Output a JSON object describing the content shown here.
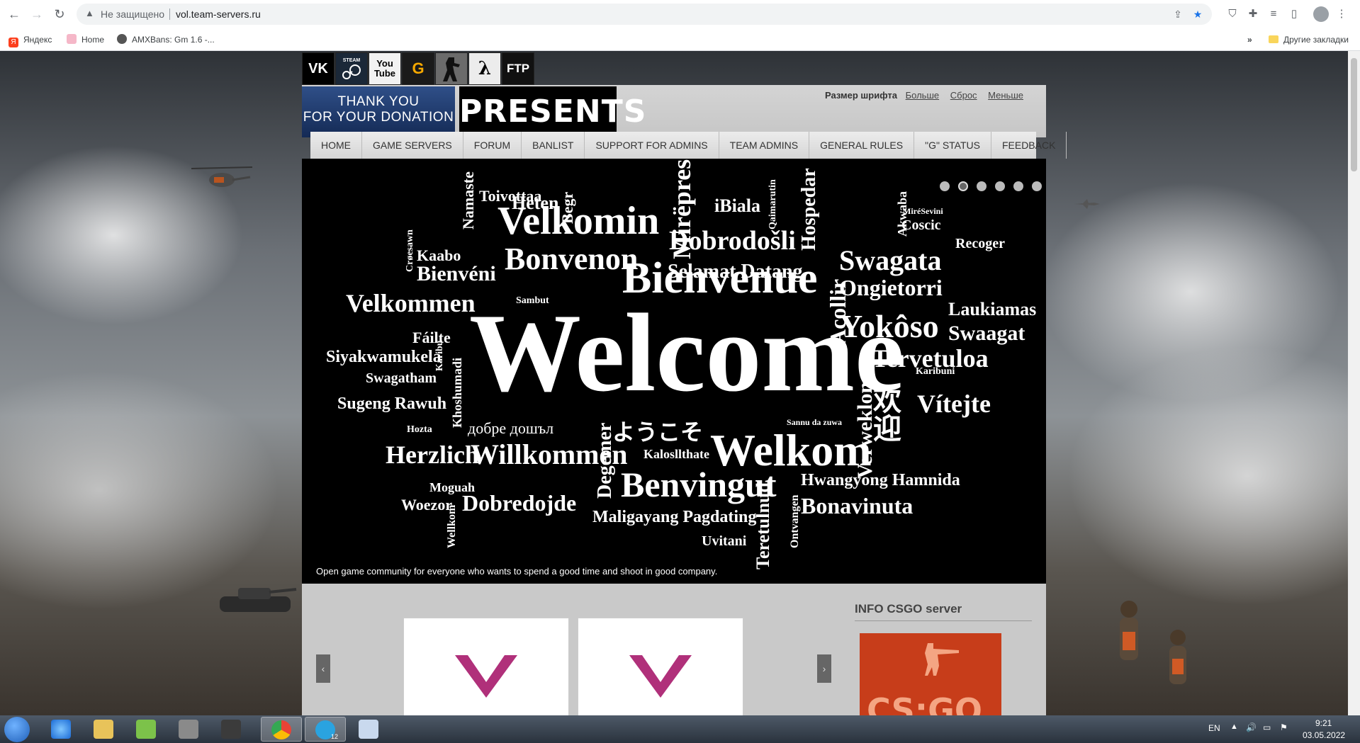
{
  "browser": {
    "not_secure": "Не защищено",
    "url": "vol.team-servers.ru",
    "bookmarks": [
      "Яндекс",
      "Home",
      "AMXBans: Gm 1.6 -..."
    ],
    "other_bookmarks": "Другие закладки",
    "overflow": "»"
  },
  "site": {
    "social": [
      "VK",
      "STEAM",
      "You Tube",
      "GameTracker",
      "Counter-Strike",
      "Half-Life",
      "FTP"
    ],
    "donation": {
      "line1": "THANK YOU",
      "line2": "FOR YOUR DONATION"
    },
    "presents": "PRESENTS",
    "font_size": {
      "label": "Размер шрифта",
      "bigger": "Больше",
      "reset": "Сброс",
      "smaller": "Меньше"
    },
    "menu": [
      "HOME",
      "GAME SERVERS",
      "FORUM",
      "BANLIST",
      "SUPPORT FOR ADMINS",
      "TEAM ADMINS",
      "GENERAL RULES",
      "\"G\" STATUS",
      "FEEDBACK"
    ],
    "slider": {
      "dots": 6,
      "active_dot": 1,
      "caption": "Open game community for everyone who wants to spend a good time and shoot in good company.",
      "words": [
        "Welcome",
        "Bienvenue",
        "Velkomin",
        "Bonvenon",
        "Welkom",
        "Willkommen",
        "Benvingut",
        "Bienvéni",
        "Velkommen",
        "Dobrodošli",
        "Selamat Datang",
        "Swagata",
        "Ongietorri",
        "Yokôso",
        "Tervetuloa",
        "Vítejte",
        "Laukiamas",
        "Swaagat",
        "Herzlich",
        "Dobredojde",
        "Maligayang Pagdating",
        "Bonavinuta",
        "Hwangyong Hamnida",
        "Siyakwamukela",
        "Sugeng Rawuh",
        "Swagatham",
        "Fáilte",
        "Kaabo",
        "Namaste",
        "Toivottaa",
        "Heten",
        "iBiala",
        "Hospedar",
        "Mirëpres",
        "Coscic",
        "Recoger",
        "Woezor",
        "Moguah",
        "Uvitani",
        "Kalosllthate",
        "добре дошъл",
        "ようこそ",
        "欢迎",
        "Degemer",
        "Verweklom",
        "Acollir",
        "Hozta",
        "Begr",
        "Qaimarutin",
        "Sambut",
        "Akwaba",
        "Karibuni",
        "Sannu da zuwa",
        "Crøesawn",
        "Wellkom",
        "Teretulnud",
        "Khoshumadi",
        "Ontvangen",
        "Karibu",
        "MiréSevini"
      ]
    },
    "info_title": "INFO CSGO server",
    "csgo_logo": "CS:GO"
  },
  "taskbar": {
    "language": "EN",
    "time": "9:21",
    "date": "03.05.2022",
    "telegram_badge": "12"
  },
  "colors": {
    "menu_bg": "#e0e0e0",
    "slider_bg": "#000000",
    "donation_bg": "#1f3a6e",
    "csgo_bg": "#c73d1a",
    "v_logo": "#b0307a"
  }
}
